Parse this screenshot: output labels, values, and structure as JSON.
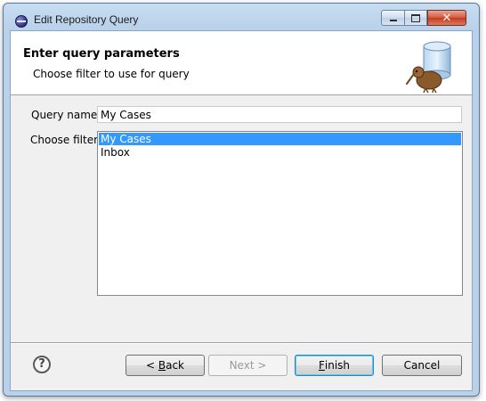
{
  "window": {
    "title": "Edit Repository Query",
    "controls": {
      "minimize": "minimize",
      "maximize": "maximize",
      "close": "close"
    }
  },
  "header": {
    "title": "Enter query parameters",
    "subtitle": "Choose filter to use for query",
    "image_icon": "repository-kiwi-icon"
  },
  "form": {
    "query_name_label": "Query name:",
    "query_name_value": "My Cases",
    "choose_filter_label": "Choose filter:",
    "filters": [
      "My Cases",
      "Inbox"
    ],
    "selected_filter": "My Cases"
  },
  "buttons": {
    "help_icon": "help-icon",
    "back_prefix": "< ",
    "back_mnemonic": "B",
    "back_rest": "ack",
    "next": "Next >",
    "finish_mnemonic": "F",
    "finish_rest": "inish",
    "cancel": "Cancel"
  },
  "colors": {
    "selection": "#3399ff",
    "frame": "#b9d1ea",
    "close_button": "#c43b1e"
  }
}
